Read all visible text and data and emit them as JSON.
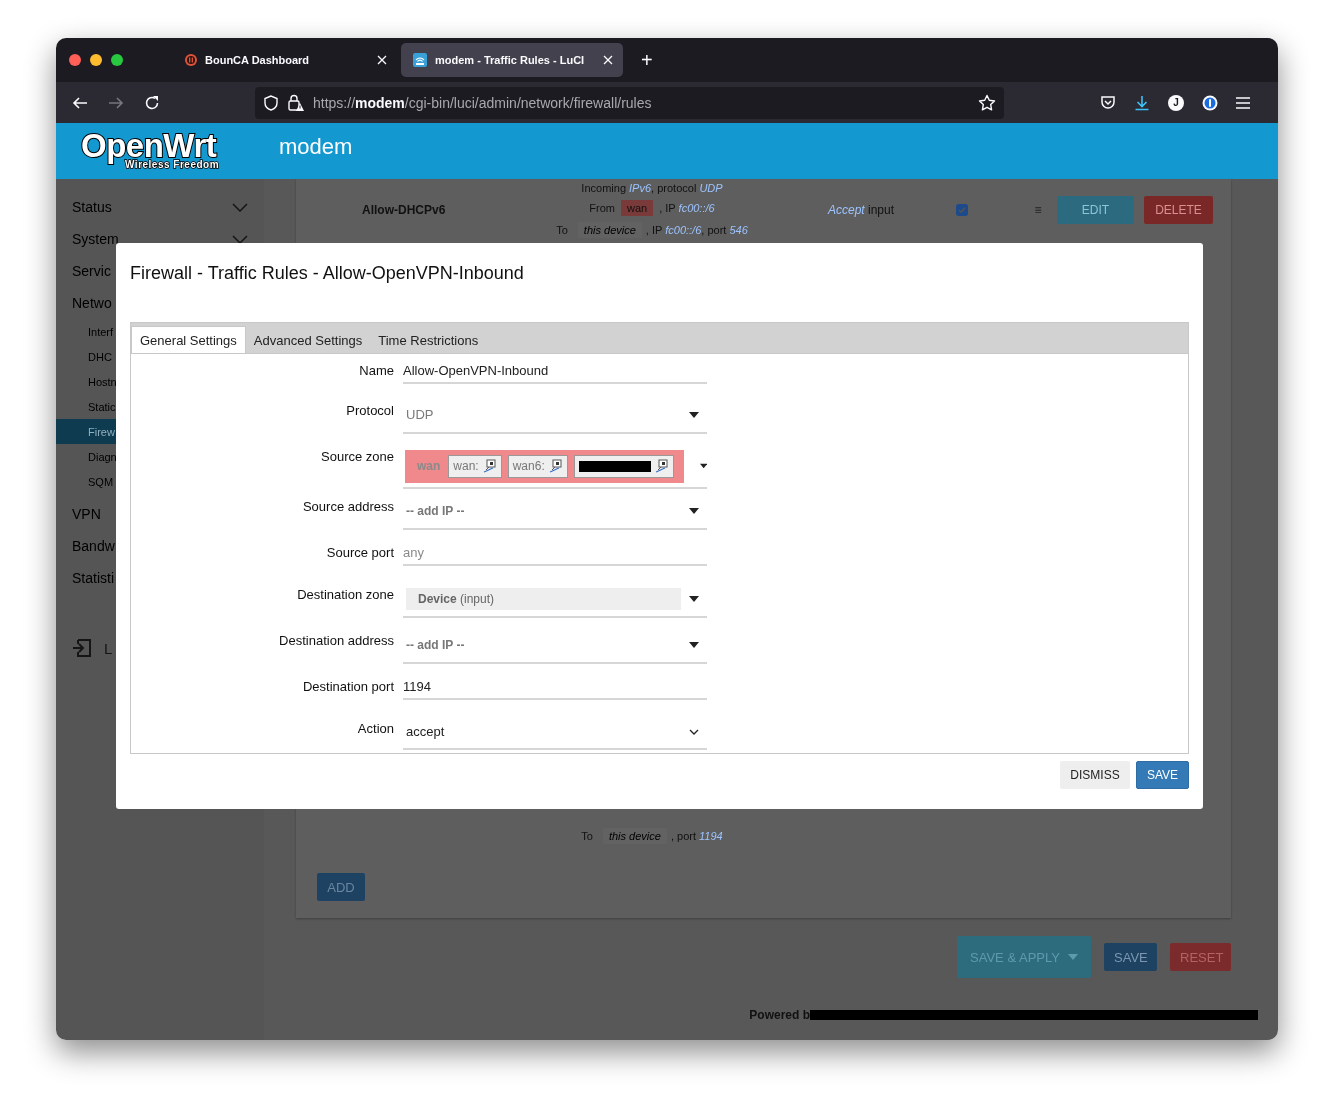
{
  "browser": {
    "tabs": [
      {
        "title": "BounCA Dashboard",
        "selected": false
      },
      {
        "title": "modem - Traffic Rules - LuCI",
        "selected": true
      }
    ],
    "new_tab": "+",
    "url": "https://**modem**/cgi-bin/luci/admin/network/firewall/rules",
    "profile_initial": "J"
  },
  "header": {
    "logo": "OpenWrt",
    "logo_tagline": "Wireless Freedom",
    "hostname": "modem"
  },
  "sidebar": {
    "items": [
      {
        "label": "Status",
        "expanded": false
      },
      {
        "label": "System",
        "expanded": false
      },
      {
        "label": "Servic"
      },
      {
        "label": "Netwo",
        "children": [
          {
            "label": "Interf",
            "selected": false
          },
          {
            "label": "DHC",
            "selected": false
          },
          {
            "label": "Hostn",
            "selected": false
          },
          {
            "label": "Static",
            "selected": false
          },
          {
            "label": "Firew",
            "selected": true
          },
          {
            "label": "Diagn",
            "selected": false
          },
          {
            "label": "SQM",
            "selected": false
          }
        ]
      },
      {
        "label": "VPN"
      },
      {
        "label": "Bandw"
      },
      {
        "label": "Statisti"
      }
    ],
    "logout": "L"
  },
  "rules": [
    {
      "name": "Allow-DHCPv6",
      "match_lines": [
        [
          {
            "kind": "text",
            "text": "Incoming *IPv6*, protocol *UDP*"
          }
        ],
        [
          {
            "kind": "text",
            "text": "From"
          },
          {
            "kind": "zone",
            "text": "wan"
          },
          {
            "kind": "text",
            "text": ", IP *fc00::/6*"
          }
        ],
        [
          {
            "kind": "text",
            "text": "To"
          },
          {
            "kind": "device",
            "text": "*this device*"
          },
          {
            "kind": "text",
            "text": ", IP *fc00::/6*, port *546*"
          }
        ]
      ],
      "action": "*Accept* input",
      "enabled": true,
      "handle": "≡",
      "edit": "EDIT",
      "delete": "DELETE"
    },
    {
      "match_lines": [
        [
          {
            "kind": "text",
            "text": "To"
          },
          {
            "kind": "device",
            "text": "*this device*"
          },
          {
            "kind": "text",
            "text": ", port *1194*"
          }
        ]
      ]
    }
  ],
  "add_button": "ADD",
  "actions": [
    {
      "kind": "apply",
      "label": "SAVE & APPLY"
    },
    {
      "kind": "save",
      "label": "SAVE"
    },
    {
      "kind": "reset",
      "label": "RESET"
    }
  ],
  "footer": {
    "text": "Powered b",
    "redacted": true
  },
  "modal": {
    "title": "Firewall - Traffic Rules - Allow-OpenVPN-Inbound",
    "tabs": [
      {
        "label": "General Settings",
        "selected": true
      },
      {
        "label": "Advanced Settings",
        "selected": false
      },
      {
        "label": "Time Restrictions",
        "selected": false
      }
    ],
    "fields": [
      {
        "label": "Name",
        "kind": "text",
        "value": "Allow-OpenVPN-Inbound"
      },
      {
        "label": "Protocol",
        "kind": "select",
        "value": "UDP"
      },
      {
        "label": "Source zone",
        "kind": "zones",
        "zone": "wan",
        "networks": [
          {
            "label": "wan:"
          },
          {
            "label": "wan6:"
          },
          {
            "redacted": true
          }
        ]
      },
      {
        "label": "Source address",
        "kind": "add",
        "placeholder": "-- add IP --"
      },
      {
        "label": "Source port",
        "kind": "text",
        "placeholder": "any"
      },
      {
        "label": "Destination zone",
        "kind": "device",
        "value": "**Device** (input)"
      },
      {
        "label": "Destination address",
        "kind": "add",
        "placeholder": "-- add IP --"
      },
      {
        "label": "Destination port",
        "kind": "text",
        "value": "1194"
      },
      {
        "label": "Action",
        "kind": "native",
        "value": "accept"
      }
    ],
    "buttons": [
      {
        "kind": "dismiss",
        "label": "DISMISS"
      },
      {
        "kind": "save",
        "label": "SAVE"
      }
    ]
  }
}
